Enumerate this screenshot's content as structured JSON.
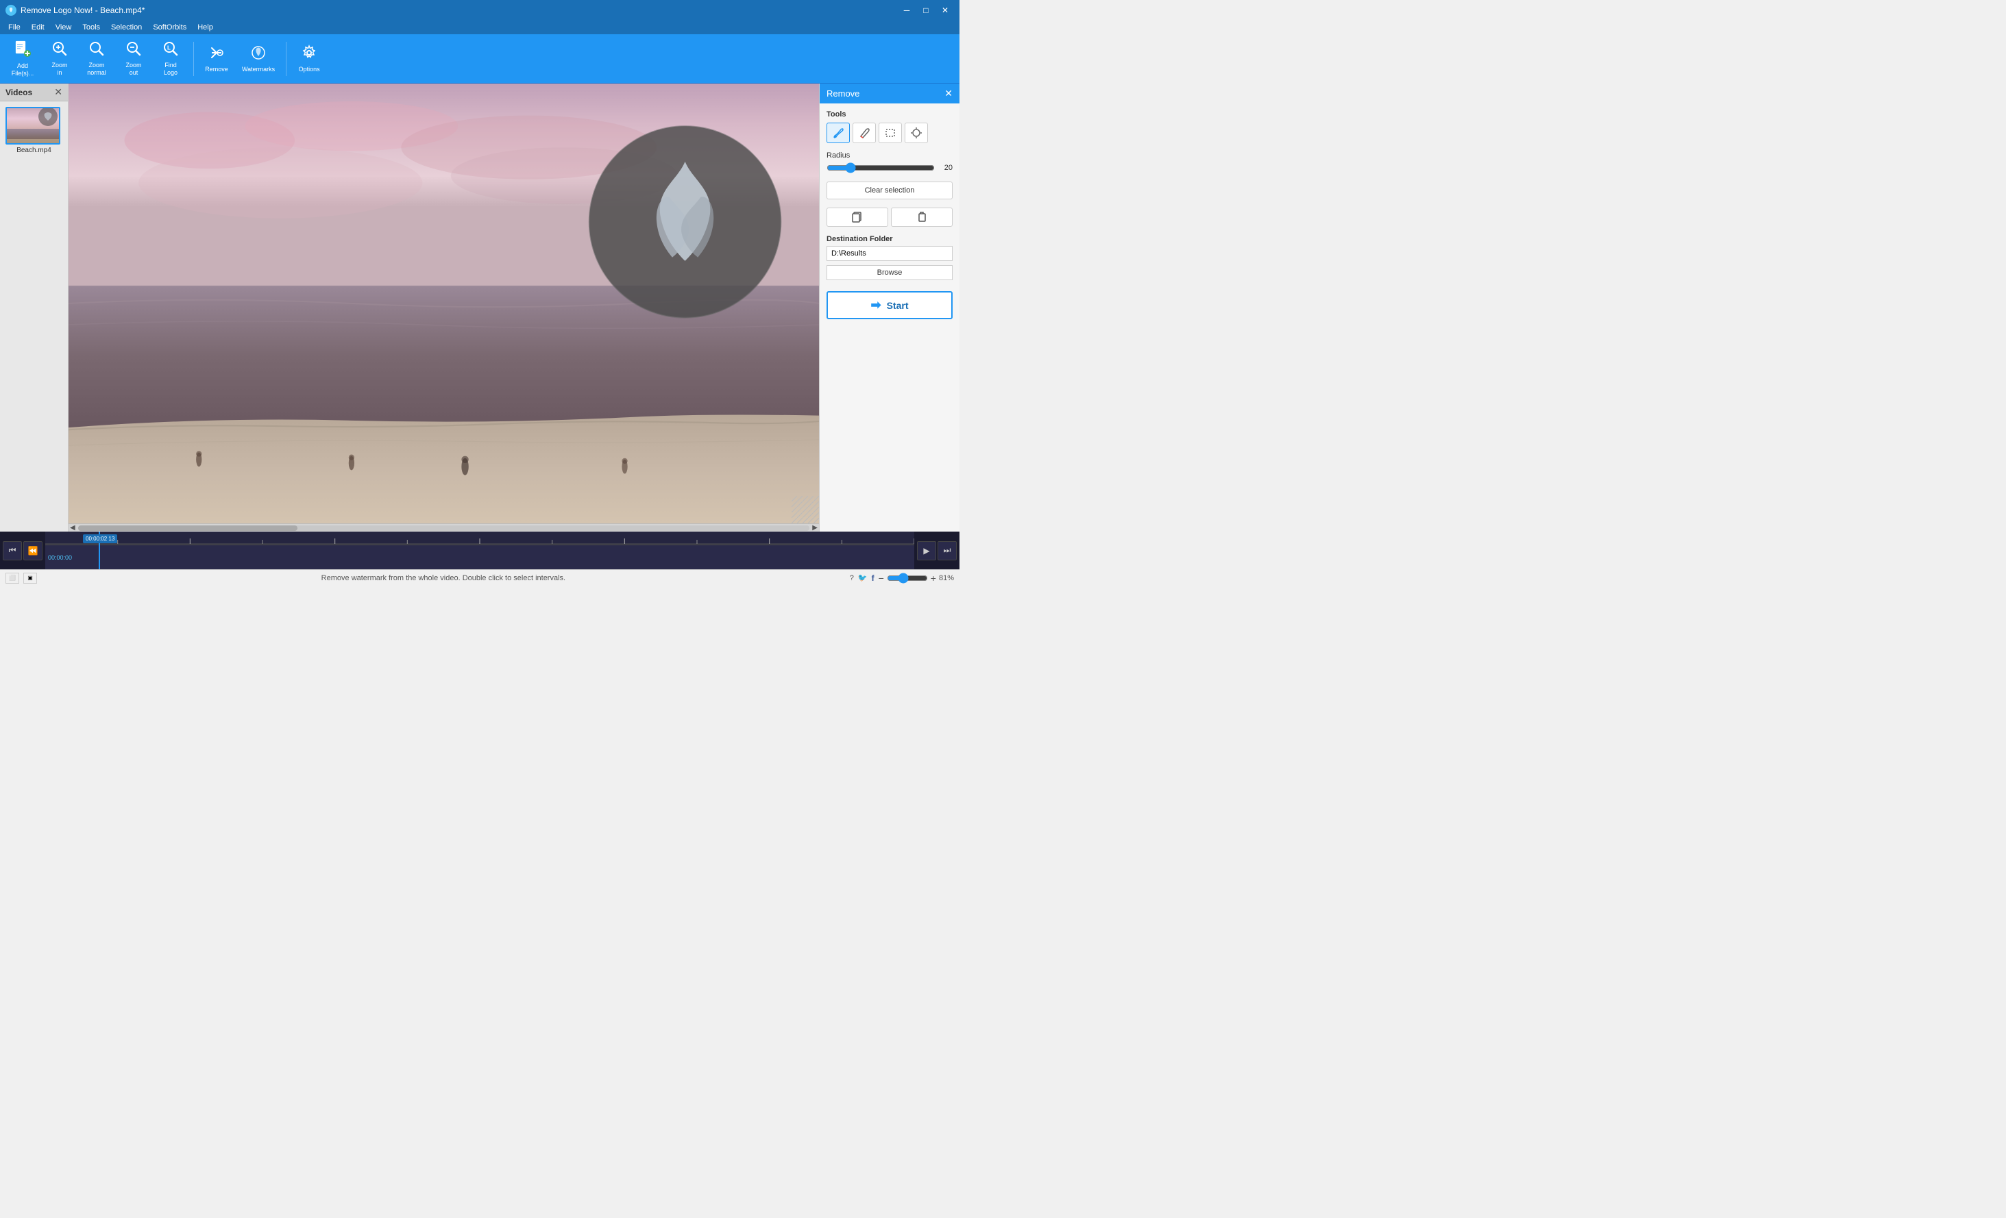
{
  "window": {
    "title": "Remove Logo Now! - Beach.mp4*",
    "icon": "🔵"
  },
  "titlebar": {
    "minimize_label": "─",
    "maximize_label": "□",
    "close_label": "✕"
  },
  "menubar": {
    "items": [
      "File",
      "Edit",
      "View",
      "Tools",
      "Selection",
      "SoftOrbits",
      "Help"
    ]
  },
  "toolbar": {
    "buttons": [
      {
        "id": "add-files",
        "icon": "📄",
        "label": "Add\nFile(s)..."
      },
      {
        "id": "zoom-in",
        "icon": "🔍",
        "label": "Zoom\nin"
      },
      {
        "id": "zoom-normal",
        "icon": "🔍",
        "label": "Zoom\nnormal"
      },
      {
        "id": "zoom-out",
        "icon": "🔍",
        "label": "Zoom\nout"
      },
      {
        "id": "find-logo",
        "icon": "🔍",
        "label": "Find\nLogo"
      },
      {
        "id": "remove",
        "icon": "🖊",
        "label": "Remove"
      },
      {
        "id": "watermarks",
        "icon": "💧",
        "label": "Watermarks"
      },
      {
        "id": "options",
        "icon": "⚙",
        "label": "Options"
      }
    ]
  },
  "videos_panel": {
    "title": "Videos",
    "close_label": "✕",
    "videos": [
      {
        "name": "Beach.mp4",
        "selected": true
      }
    ]
  },
  "video": {
    "current_time": "00:00:02 13",
    "start_time": "00:00:00",
    "has_watermark": true
  },
  "timeline": {
    "left_controls": [
      "⏮",
      "⏪"
    ],
    "right_controls": [
      "▶",
      "⏭"
    ],
    "time_position": "00:00:02 13",
    "start_label": "00:00:00"
  },
  "status_bar": {
    "message": "Remove watermark from the whole video. Double click to select intervals.",
    "zoom_label": "81%",
    "help_icon": "?",
    "twitter_icon": "🐦",
    "facebook_icon": "f"
  },
  "right_panel": {
    "title": "Remove",
    "close_label": "✕",
    "tools_label": "Tools",
    "tools": [
      {
        "id": "brush",
        "icon": "✏",
        "active": true,
        "label": "Brush tool"
      },
      {
        "id": "eraser",
        "icon": "✏",
        "active": false,
        "label": "Eraser tool"
      },
      {
        "id": "rect",
        "icon": "⬜",
        "active": false,
        "label": "Rectangle tool"
      },
      {
        "id": "magic",
        "icon": "⏱",
        "active": false,
        "label": "Magic wand tool"
      }
    ],
    "radius_label": "Radius",
    "radius_value": 20,
    "radius_min": 1,
    "radius_max": 100,
    "clear_selection_label": "Clear selection",
    "copy_icon": "⧉",
    "paste_icon": "📋",
    "destination_folder_label": "Destination Folder",
    "destination_folder_value": "D:\\Results",
    "browse_label": "Browse",
    "start_label": "Start"
  }
}
